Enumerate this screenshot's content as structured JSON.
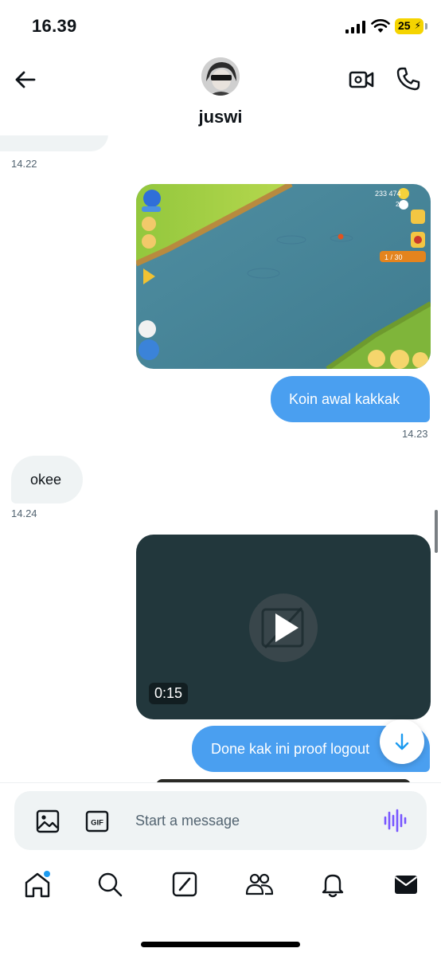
{
  "status_bar": {
    "time": "16.39",
    "battery": "25"
  },
  "header": {
    "contact_name": "juswi"
  },
  "messages": [
    {
      "type": "timestamp",
      "side": "in",
      "time": "14.22"
    },
    {
      "type": "image",
      "side": "out"
    },
    {
      "type": "text",
      "side": "out",
      "text": "Koin awal kakkak",
      "time": "14.23"
    },
    {
      "type": "text",
      "side": "in",
      "text": "okee",
      "time": "14.24"
    },
    {
      "type": "video",
      "side": "out",
      "duration": "0:15"
    },
    {
      "type": "text",
      "side": "out",
      "text": "Done kak ini proof logout"
    }
  ],
  "game_hud": {
    "coins": "233 474",
    "diamonds": "2",
    "level": "1",
    "progress": "1 / 30"
  },
  "composer": {
    "placeholder": "Start a message",
    "gif_label": "GIF"
  },
  "nav": [
    "home",
    "search",
    "grok",
    "communities",
    "notifications",
    "messages"
  ],
  "colors": {
    "accent": "#1d9bf0",
    "outgoing_bubble": "#4a9ff0",
    "incoming_bubble": "#eff3f4",
    "voice": "#7856ff"
  }
}
